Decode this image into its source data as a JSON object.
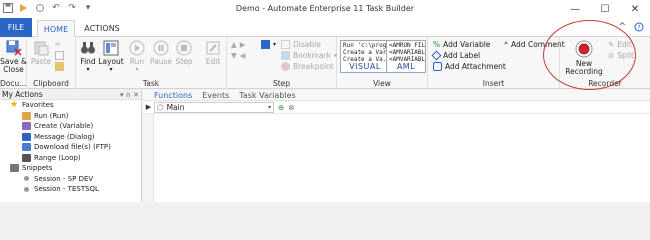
{
  "window": {
    "title": "Demo - Automate Enterprise 11 Task Builder",
    "controls": [
      "—",
      "☐",
      "✕"
    ]
  },
  "tabs": {
    "file": "FILE",
    "home": "HOME",
    "actions": "ACTIONS",
    "right_icons": [
      "^",
      "?"
    ]
  },
  "ribbon": {
    "document": {
      "label": "Docu...",
      "save_close": "Save &\nClose"
    },
    "clipboard": {
      "label": "Clipboard",
      "paste": "Paste"
    },
    "task": {
      "label": "Task",
      "find": "Find",
      "layout": "Layout",
      "run": "Run",
      "pause": "Pause",
      "step": "Step",
      "edit": "Edit"
    },
    "step": {
      "label": "Step",
      "disable": "Disable",
      "bookmark": "Bookmark",
      "breakpoint": "Breakpoint"
    },
    "view": {
      "label": "View",
      "visual_code": "Run 'c:\\progr\nCreate a Vari\nCreate a Va..",
      "visual": "VISUAL",
      "aml_code": "<AMRUN FIL\n<AMVARIABL\n<AMVARIABL",
      "aml": "AML"
    },
    "insert": {
      "label": "Insert",
      "add_variable": "Add Variable",
      "add_label": "Add Label",
      "add_attachment": "Add Attachment",
      "add_comment": "Add Comment"
    },
    "recorder": {
      "label": "Recorder",
      "new_recording": "New\nRecording",
      "edit": "Edit",
      "split": "Split"
    }
  },
  "left_panel": {
    "title": "My Actions",
    "header_controls": "▾ ∩ ✕",
    "items": [
      {
        "label": "Favorites",
        "indent": 1
      },
      {
        "label": "Run (Run)",
        "indent": 2
      },
      {
        "label": "Create (Variable)",
        "indent": 2
      },
      {
        "label": "Message (Dialog)",
        "indent": 2
      },
      {
        "label": "Download file(s) (FTP)",
        "indent": 2
      },
      {
        "label": "Range (Loop)",
        "indent": 2
      },
      {
        "label": "Snippets",
        "indent": 1
      },
      {
        "label": "Session - SP DEV",
        "indent": 2
      },
      {
        "label": "Session - TESTSQL",
        "indent": 2
      }
    ]
  },
  "editor": {
    "tabs": [
      "Functions",
      "Events",
      "Task Variables"
    ],
    "function_select": "Main"
  },
  "colors": {
    "accent": "#2b65c5",
    "record": "#c0262c",
    "annotation_oval": "#c93a3a"
  }
}
